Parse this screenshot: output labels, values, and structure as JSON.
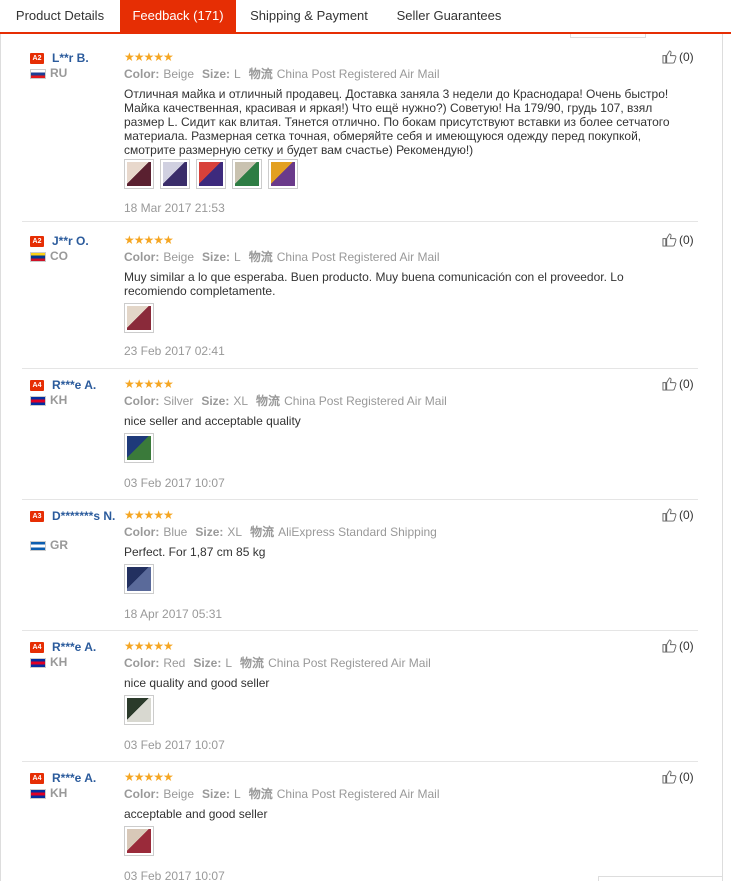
{
  "tabs": [
    "Product Details",
    "Feedback (171)",
    "Shipping & Payment",
    "Seller Guarantees"
  ],
  "labels": {
    "color": "Color:",
    "size": "Size:",
    "shipping_label": "物流"
  },
  "stars": "★★★★★",
  "reviews": [
    {
      "badge": "A2",
      "name": "L**r B.",
      "country": "RU",
      "flag": [
        "#ffffff",
        "#1c3f95",
        "#e4181c"
      ],
      "color": "Beige",
      "size": "L",
      "shipping": "China Post Registered Air Mail",
      "text": "Отличная майка и отличный продавец. Доставка заняла 3 недели до Краснодара! Очень быстро! Майка качественная, красивая и яркая!) Что ещё нужно?) Советую! На 179/90, грудь 107, взял размер L. Сидит как влитая. Тянется отлично. По бокам присутствуют вставки из более сетчатого материала. Размерная сетка точная, обмеряйте себя и имеющуюся одежду перед покупкой, смотрите размерную сетку и будет вам счастье) Рекомендую!)",
      "images": [
        [
          "#e8d8cc",
          "#5a2030"
        ],
        [
          "#d0d0e0",
          "#3a2d6a"
        ],
        [
          "#d8413a",
          "#3d2a7d"
        ],
        [
          "#c9c2b0",
          "#2e7d44"
        ],
        [
          "#e3a020",
          "#6a3a8a"
        ]
      ],
      "date": "18 Mar 2017 21:53",
      "helpful": "(0)"
    },
    {
      "badge": "A2",
      "name": "J**r O.",
      "country": "CO",
      "flag": [
        "#fcd116",
        "#003893",
        "#ce1126"
      ],
      "color": "Beige",
      "size": "L",
      "shipping": "China Post Registered Air Mail",
      "text": "Muy similar a lo que esperaba. Buen producto. Muy buena comunicación con el proveedor. Lo recomiendo completamente.",
      "images": [
        [
          "#e3d6c8",
          "#8a2a3a"
        ]
      ],
      "date": "23 Feb 2017 02:41",
      "helpful": "(0)"
    },
    {
      "badge": "A4",
      "name": "R***e A.",
      "country": "KH",
      "flag": [
        "#032ea1",
        "#e00025",
        "#032ea1"
      ],
      "color": "Silver",
      "size": "XL",
      "shipping": "China Post Registered Air Mail",
      "text": "nice seller and acceptable quality",
      "images": [
        [
          "#1e3a7a",
          "#3a7a3a"
        ]
      ],
      "date": "03 Feb 2017 10:07",
      "helpful": "(0)"
    },
    {
      "badge": "A3",
      "name": "D*******s N.",
      "country": "GR",
      "flag": [
        "#0d5eaf",
        "#ffffff",
        "#0d5eaf"
      ],
      "color": "Blue",
      "size": "XL",
      "shipping": "AliExpress Standard Shipping",
      "text": "Perfect. For 1,87 cm 85 kg",
      "images": [
        [
          "#223060",
          "#5a6a9a"
        ]
      ],
      "date": "18 Apr 2017 05:31",
      "helpful": "(0)"
    },
    {
      "badge": "A4",
      "name": "R***e A.",
      "country": "KH",
      "flag": [
        "#032ea1",
        "#e00025",
        "#032ea1"
      ],
      "color": "Red",
      "size": "L",
      "shipping": "China Post Registered Air Mail",
      "text": "nice quality and good seller",
      "images": [
        [
          "#2a3a2a",
          "#d8d8d0"
        ]
      ],
      "date": "03 Feb 2017 10:07",
      "helpful": "(0)"
    },
    {
      "badge": "A4",
      "name": "R***e A.",
      "country": "KH",
      "flag": [
        "#032ea1",
        "#e00025",
        "#032ea1"
      ],
      "color": "Beige",
      "size": "L",
      "shipping": "China Post Registered Air Mail",
      "text": "acceptable and good seller",
      "images": [
        [
          "#d8c8b8",
          "#9a2a3a"
        ]
      ],
      "date": "03 Feb 2017 10:07",
      "helpful": "(0)"
    }
  ]
}
